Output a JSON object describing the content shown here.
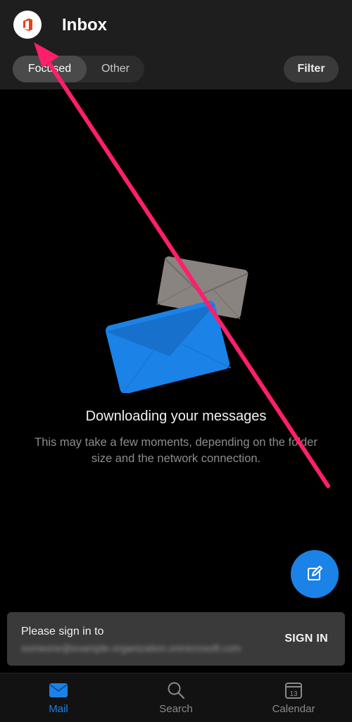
{
  "header": {
    "title": "Inbox",
    "logo_icon": "office-icon",
    "tabs": [
      {
        "label": "Focused",
        "active": true
      },
      {
        "label": "Other",
        "active": false
      }
    ],
    "filter_label": "Filter"
  },
  "empty_state": {
    "title": "Downloading your messages",
    "description": "This may take a few moments, depending on the folder size and the network connection."
  },
  "signin": {
    "label": "Please sign in to",
    "email_blurred": "someone@example-organization.onmicrosoft.com",
    "button": "SIGN IN"
  },
  "bottom_nav": {
    "mail": "Mail",
    "search": "Search",
    "calendar": "Calendar",
    "calendar_day": "13"
  },
  "colors": {
    "accent": "#1b82e7",
    "annotation_arrow": "#ff1f6b"
  }
}
